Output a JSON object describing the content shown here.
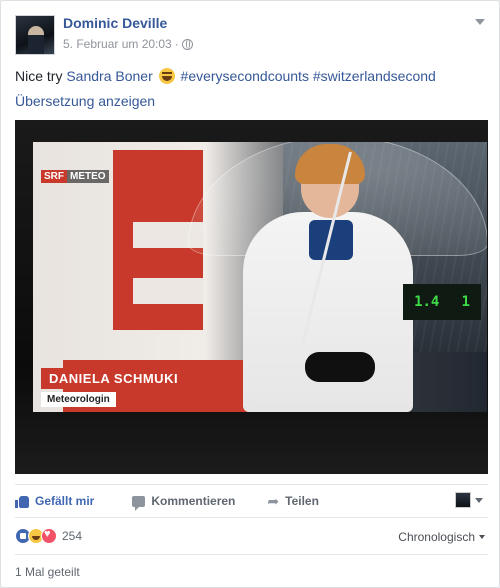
{
  "post": {
    "author": "Dominic Deville",
    "timestamp": "5. Februar um 20:03",
    "meta_separator": "·",
    "text_start": "Nice try ",
    "mention": "Sandra Boner",
    "hashtag_1": "#everysecondcounts",
    "hashtag_2": "#switzerlandsecond",
    "translate_link": "Übersetzung anzeigen",
    "privacy_icon": "globe-icon",
    "emoji": "laughing-face"
  },
  "image": {
    "channel_logo": "SRF",
    "channel_sub": "METEO",
    "lower_third_name": "DANIELA SCHMUKI",
    "lower_third_role": "Meteorologin",
    "display_left": "1.4",
    "display_right": "1"
  },
  "actions": {
    "like": "Gefällt mir",
    "comment": "Kommentieren",
    "share": "Teilen"
  },
  "reactions": {
    "count": "254",
    "types": [
      "like",
      "haha",
      "love"
    ],
    "sort_label": "Chronologisch"
  },
  "shares": {
    "label": "1 Mal geteilt"
  },
  "colors": {
    "link": "#365899",
    "like_blue": "#4267b2",
    "muted": "#90949c",
    "srf_red": "#c8392b"
  }
}
